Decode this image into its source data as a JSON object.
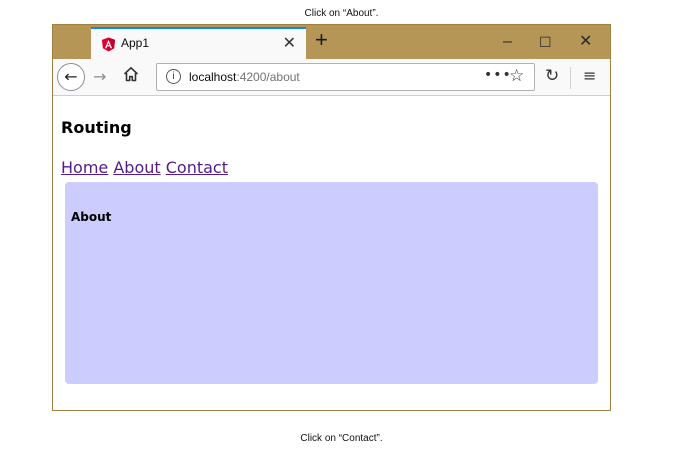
{
  "captions": {
    "top": "Click on “About”.",
    "bottom": "Click on “Contact”."
  },
  "browser": {
    "tab": {
      "title": "App1",
      "favicon": "angular-icon",
      "close_glyph": "✕"
    },
    "new_tab_glyph": "+",
    "window_controls": {
      "minimize": "–",
      "maximize": "☐",
      "close": "✕"
    },
    "nav": {
      "back_glyph": "←",
      "forward_glyph": "→",
      "reload_glyph": "↻",
      "menu_glyph": "≡"
    },
    "url": {
      "host": "localhost",
      "rest": ":4200/about",
      "info_glyph": "i",
      "more_glyph": "•••",
      "bookmark_glyph": "☆"
    },
    "colors": {
      "titlebar": "#b59656",
      "tab_accent": "#0a84ff"
    }
  },
  "page": {
    "title": "Routing",
    "links": [
      {
        "label": "Home"
      },
      {
        "label": "About"
      },
      {
        "label": "Contact"
      }
    ],
    "outlet": {
      "heading": "About",
      "background": "#ccccff"
    },
    "link_color": "#551a8b"
  }
}
